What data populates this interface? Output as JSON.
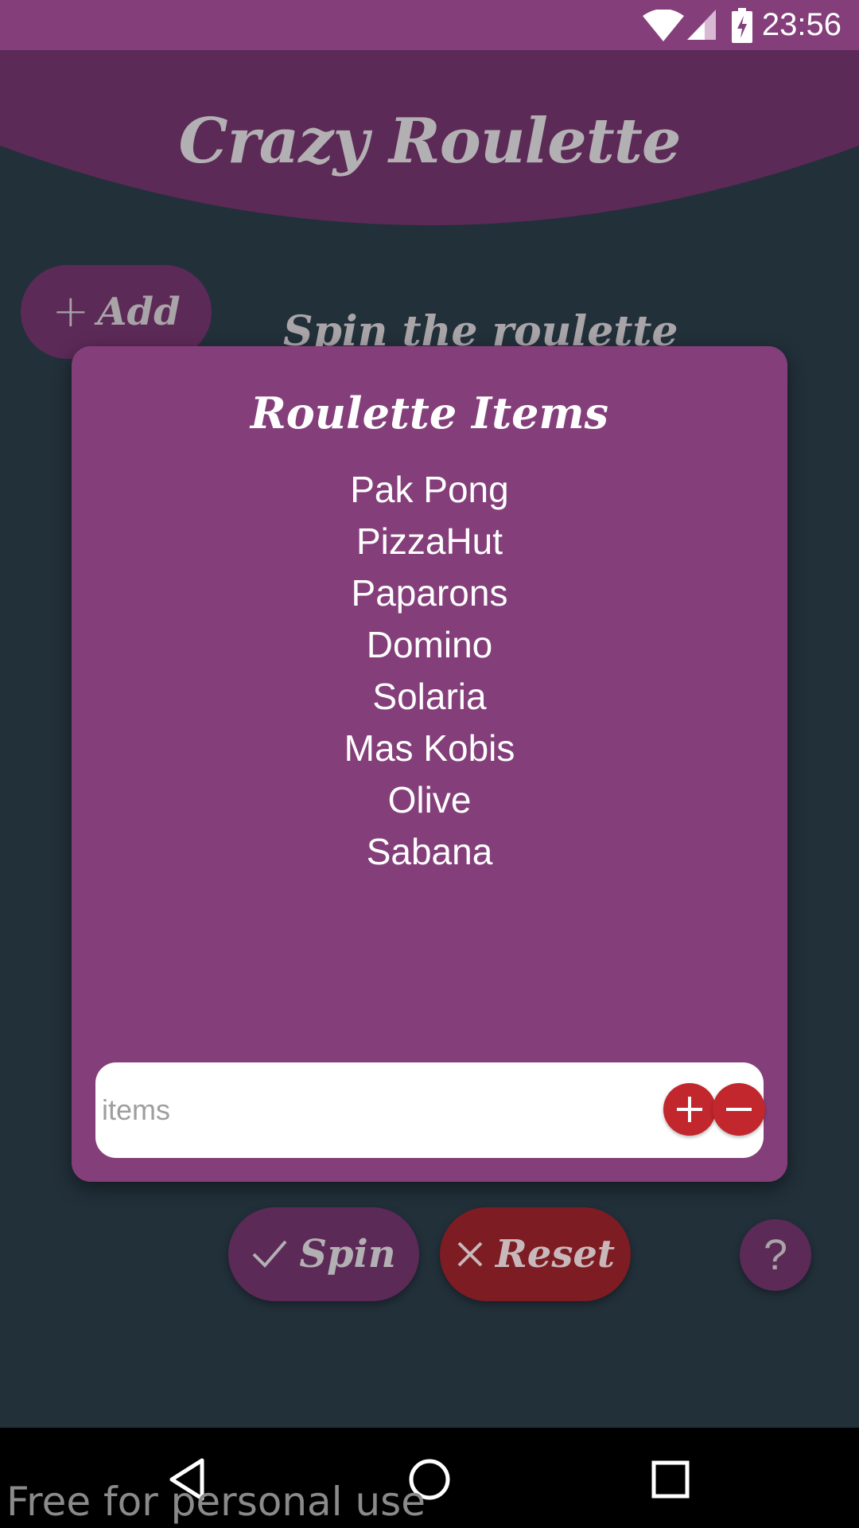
{
  "status_bar": {
    "time": "23:56"
  },
  "header": {
    "title": "Crazy Roulette"
  },
  "main": {
    "add_button_label": "Add",
    "spin_caption": "Spin the roulette"
  },
  "dialog": {
    "title": "Roulette Items",
    "items": [
      "Pak Pong",
      "PizzaHut",
      "Paparons",
      "Domino",
      "Solaria",
      "Mas Kobis",
      "Olive",
      "Sabana"
    ],
    "input": {
      "value": "",
      "placeholder": "items"
    }
  },
  "actions": {
    "spin_label": "Spin",
    "reset_label": "Reset",
    "help_label": "?"
  },
  "watermark": "Free for personal use",
  "icons": [
    "wifi-icon",
    "signal-icon",
    "battery-charging-icon",
    "add-icon",
    "remove-icon",
    "check-icon",
    "close-icon",
    "back-icon",
    "home-icon",
    "recents-icon"
  ],
  "colors": {
    "accent": "#843f7a",
    "accent_dark": "#5c2a57",
    "background": "#22303a",
    "danger": "#c1272d",
    "reset": "#7d1c22"
  }
}
